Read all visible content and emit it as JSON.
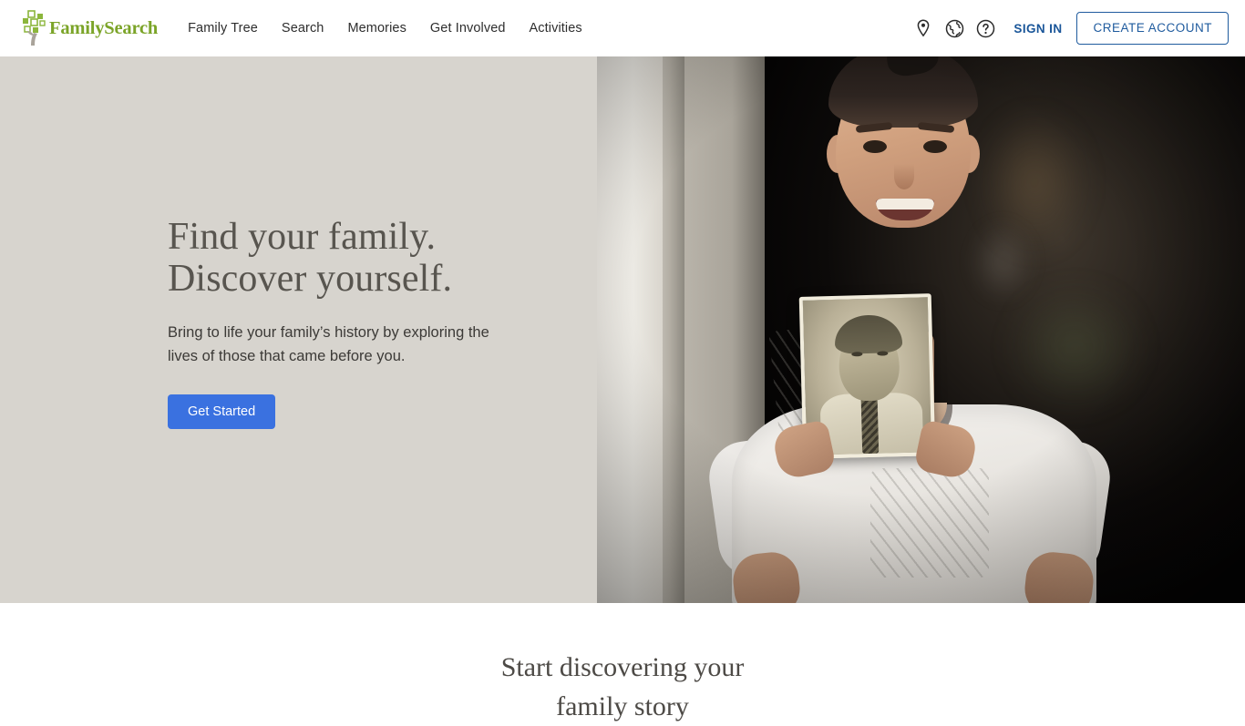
{
  "header": {
    "logo": {
      "name": "FamilySearch",
      "icon": "family-tree-squares-logo",
      "color": "#7ba428"
    },
    "nav": [
      {
        "label": "Family Tree"
      },
      {
        "label": "Search"
      },
      {
        "label": "Memories"
      },
      {
        "label": "Get Involved"
      },
      {
        "label": "Activities"
      }
    ],
    "icons": [
      {
        "name": "location-pin-icon"
      },
      {
        "name": "globe-icon"
      },
      {
        "name": "help-circle-icon"
      }
    ],
    "sign_in_label": "SIGN IN",
    "create_account_label": "CREATE ACCOUNT",
    "link_color": "#1f5b9e"
  },
  "hero": {
    "title_line1": "Find your family.",
    "title_line2": "Discover yourself.",
    "subtitle": "Bring to life your family’s history by exploring the lives of those that came before you.",
    "cta_label": "Get Started",
    "cta_color": "#3a71e0",
    "background_color": "#d7d4ce",
    "image_alt": "Smiling boy in a white t-shirt holding a vintage sepia portrait photograph of a boy in shirt and tie"
  },
  "section": {
    "title_line1": "Start discovering your",
    "title_line2": "family story"
  }
}
